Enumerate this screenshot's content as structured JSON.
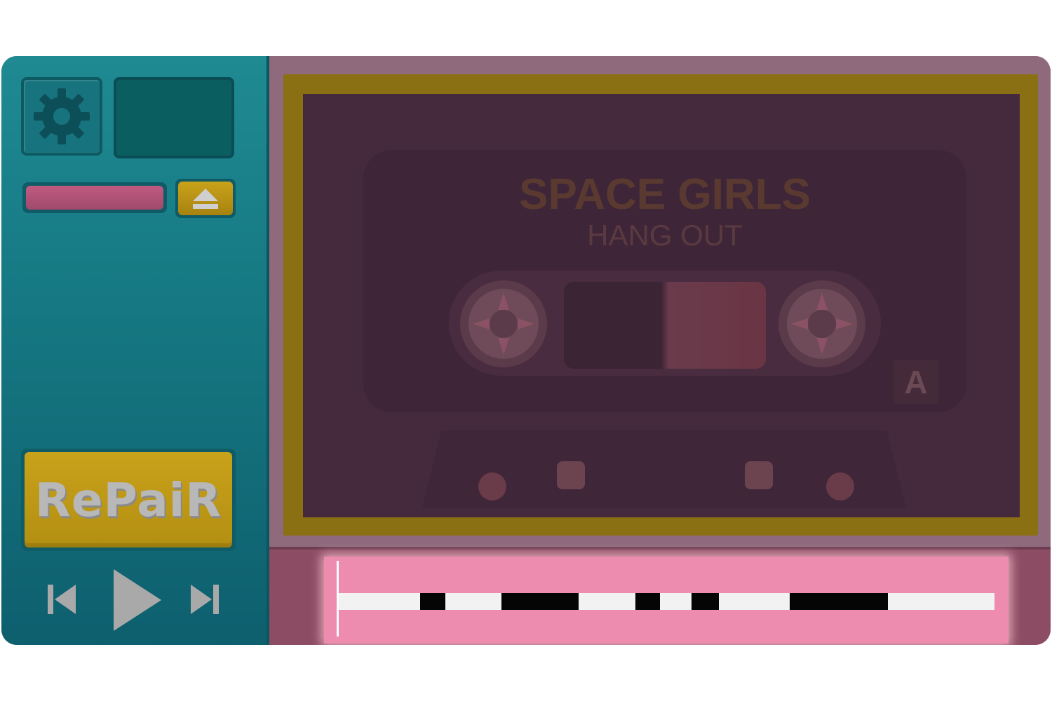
{
  "controls": {
    "settings_icon": "gear-icon",
    "eject_icon": "eject-icon",
    "repair_label": "RePaiR",
    "prev_icon": "skip-back-icon",
    "play_icon": "play-icon",
    "next_icon": "skip-forward-icon"
  },
  "cassette": {
    "title": "SPACE GIRLS",
    "subtitle": "HANG OUT",
    "side": "A"
  },
  "progress": {
    "position": 0.0,
    "damaged_segments": [
      [
        0.125,
        0.163
      ],
      [
        0.249,
        0.366
      ],
      [
        0.453,
        0.49
      ],
      [
        0.538,
        0.58
      ],
      [
        0.688,
        0.838
      ]
    ]
  },
  "colors": {
    "panel_teal": "#157781",
    "accent_yellow": "#c9a21a",
    "tape_pink": "#ee8cb0",
    "cassette_body": "#452a3e"
  }
}
